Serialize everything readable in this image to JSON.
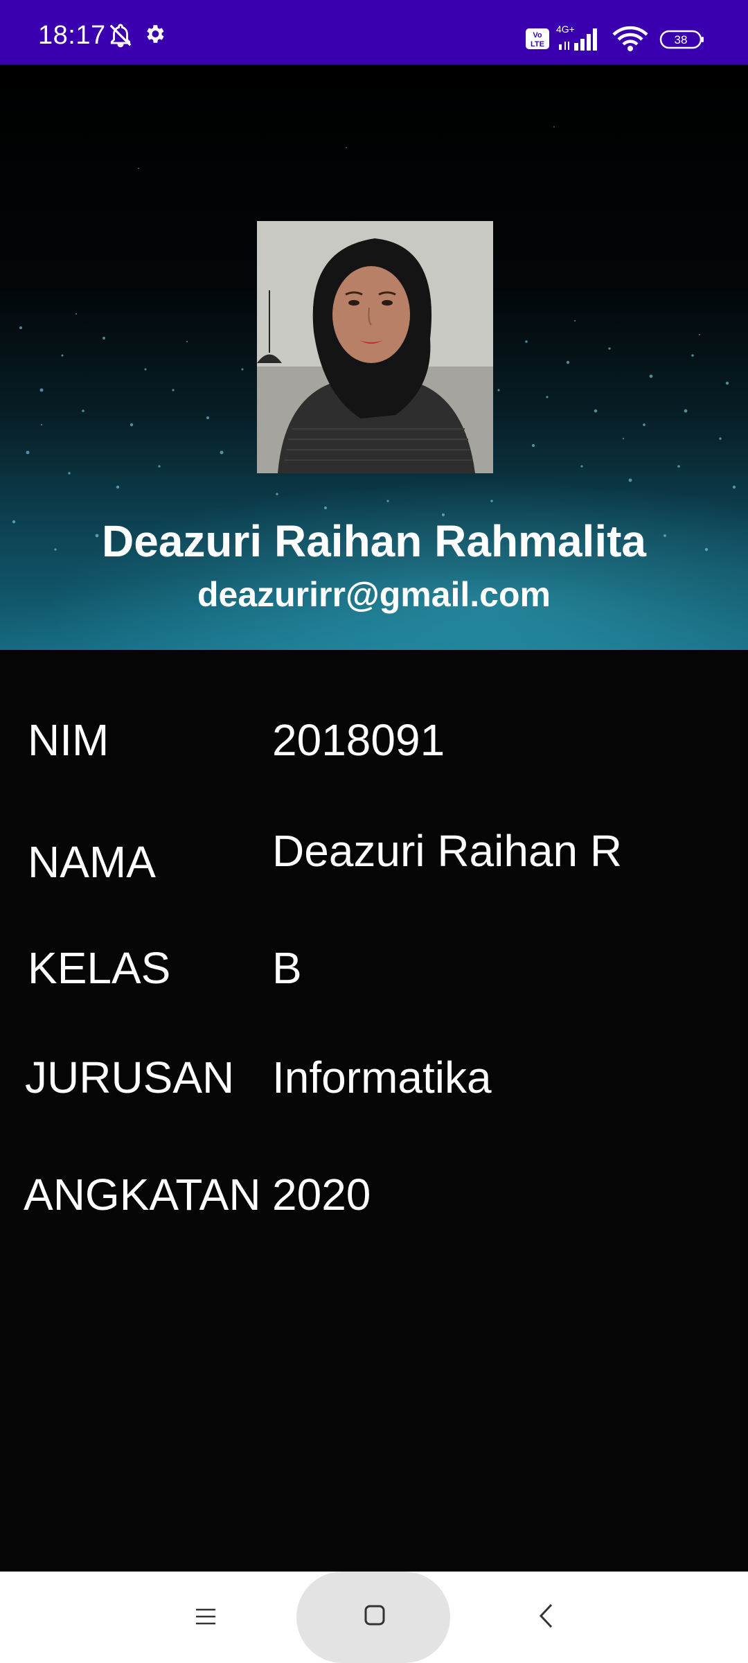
{
  "status_bar": {
    "time": "18:17",
    "network": "4G+",
    "volte": "Vo LTE",
    "battery": "38",
    "icons": [
      "bell-off-icon",
      "settings-icon",
      "volte-icon",
      "signal-icon",
      "wifi-icon",
      "battery-icon"
    ]
  },
  "profile": {
    "name": "Deazuri Raihan Rahmalita",
    "email": "deazurirr@gmail.com"
  },
  "details": {
    "nim": {
      "label": "NIM",
      "value": "2018091"
    },
    "nama": {
      "label": "NAMA",
      "value": "Deazuri Raihan R"
    },
    "kelas": {
      "label": "KELAS",
      "value": "B"
    },
    "jurusan": {
      "label": "JURUSAN",
      "value": "Informatika"
    },
    "angkatan": {
      "label": "ANGKATAN",
      "value": "2020"
    }
  },
  "nav_bar": {
    "icons": [
      "menu-icon",
      "home-icon",
      "back-icon"
    ]
  },
  "colors": {
    "status_bar": "#3a00b0",
    "background": "#050505",
    "text": "#ffffff",
    "nav_bar": "#ffffff",
    "nav_pill": "#e3e3e3"
  }
}
